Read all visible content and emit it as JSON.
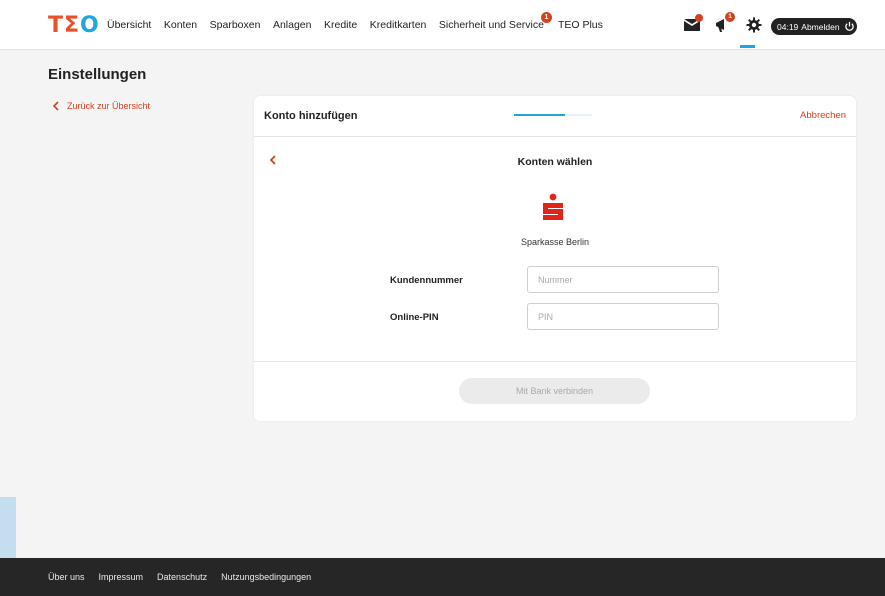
{
  "brand": {
    "logo_t": "T",
    "logo_e": "Σ",
    "logo_o": "O"
  },
  "nav": {
    "items": [
      {
        "label": "Übersicht"
      },
      {
        "label": "Konten"
      },
      {
        "label": "Sparboxen"
      },
      {
        "label": "Anlagen"
      },
      {
        "label": "Kredite"
      },
      {
        "label": "Kreditkarten"
      },
      {
        "label": "Sicherheit und Service",
        "badge": "1"
      },
      {
        "label": "TEO Plus"
      }
    ]
  },
  "header_icons": {
    "mail_icon": "envelope-icon",
    "notifications_icon": "megaphone-icon",
    "notifications_badge": "1",
    "settings_icon": "gear-icon"
  },
  "session": {
    "timer": "04:19",
    "logout_label": "Abmelden"
  },
  "page": {
    "title": "Einstellungen",
    "back_label": "Zurück zur Übersicht"
  },
  "card": {
    "title": "Konto hinzufügen",
    "cancel_label": "Abbrechen",
    "progress": 0.66,
    "step_title": "Konten wählen",
    "bank_name": "Sparkasse Berlin",
    "fields": {
      "customer_number": {
        "label": "Kundennummer",
        "placeholder": "Nummer",
        "value": ""
      },
      "pin": {
        "label": "Online-PIN",
        "placeholder": "PIN",
        "value": ""
      }
    },
    "connect_label": "Mit Bank verbinden"
  },
  "footer": {
    "links": [
      "Über uns",
      "Impressum",
      "Datenschutz",
      "Nutzungsbedingungen"
    ]
  },
  "colors": {
    "accent_red": "#d6401d",
    "accent_blue": "#1fa6dd",
    "footer_bg": "#262626"
  }
}
